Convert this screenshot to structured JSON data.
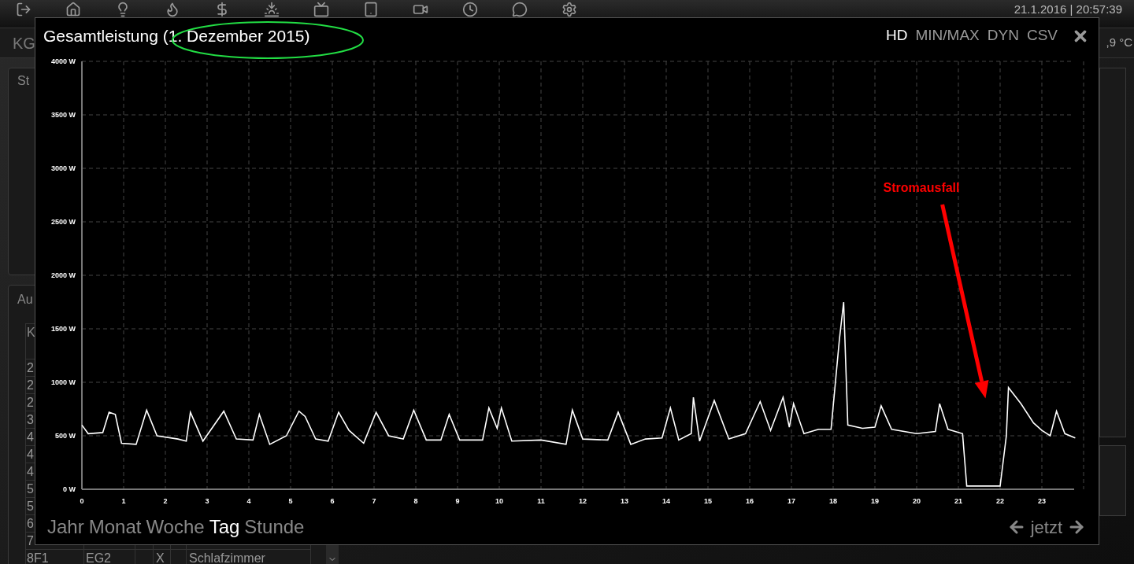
{
  "nav": {
    "datetime": "21.1.2016 | 20:57:39"
  },
  "tab_row": {
    "left_tab": "KG",
    "temperature": ",9 °C"
  },
  "panels": [
    {
      "heading": "St"
    },
    {
      "heading": "Au",
      "table": {
        "header": "K",
        "rows": [
          {
            "kennung": "2"
          },
          {
            "kennung": "2"
          },
          {
            "kennung": "2"
          },
          {
            "kennung": "3"
          },
          {
            "kennung": "4"
          },
          {
            "kennung": "4"
          },
          {
            "kennung": "4"
          },
          {
            "kennung": "5"
          },
          {
            "kennung": "5"
          },
          {
            "kennung": "6"
          },
          {
            "kennung": "7"
          },
          {
            "kennung": "8F1",
            "stockwerk": "EG2",
            "l2": "X",
            "ort": "Schlafzimmer"
          }
        ]
      }
    }
  ],
  "modal": {
    "title": "Gesamtleistung (1. Dezember 2015)",
    "options": [
      {
        "label": "HD",
        "selected": true
      },
      {
        "label": "MIN/MAX",
        "selected": false
      },
      {
        "label": "DYN",
        "selected": false
      },
      {
        "label": "CSV",
        "selected": false
      }
    ],
    "chart_data": {
      "type": "line",
      "x": [
        0,
        0.15,
        0.5,
        0.65,
        0.8,
        0.95,
        1.3,
        1.55,
        1.8,
        2.3,
        2.5,
        2.6,
        2.9,
        3.4,
        3.7,
        4.1,
        4.25,
        4.5,
        4.9,
        5.2,
        5.35,
        5.6,
        5.9,
        6.15,
        6.4,
        6.75,
        7.05,
        7.35,
        7.7,
        7.95,
        8.25,
        8.6,
        8.8,
        9.05,
        9.6,
        9.75,
        9.95,
        10.05,
        10.3,
        11,
        11.6,
        11.75,
        12,
        12.6,
        12.85,
        13.15,
        13.5,
        13.9,
        14.1,
        14.3,
        14.6,
        14.65,
        14.8,
        15.15,
        15.5,
        15.9,
        16.25,
        16.5,
        16.8,
        16.95,
        17.05,
        17.3,
        17.65,
        17.95,
        18.15,
        18.25,
        18.35,
        18.7,
        19,
        19.15,
        19.4,
        20,
        20.45,
        20.55,
        20.75,
        21.1,
        21.2,
        21.5,
        22,
        22.15,
        22.2,
        22.5,
        22.8,
        23,
        23.2,
        23.35,
        23.55,
        23.8
      ],
      "series": [
        {
          "color": "#ffffff",
          "values": [
            600,
            520,
            530,
            720,
            700,
            430,
            420,
            740,
            500,
            470,
            450,
            720,
            450,
            730,
            470,
            460,
            700,
            420,
            500,
            730,
            680,
            470,
            450,
            720,
            550,
            430,
            720,
            500,
            470,
            740,
            460,
            460,
            700,
            460,
            460,
            760,
            570,
            760,
            450,
            460,
            420,
            740,
            470,
            460,
            720,
            420,
            470,
            480,
            760,
            460,
            520,
            860,
            450,
            830,
            470,
            520,
            820,
            550,
            860,
            580,
            800,
            520,
            560,
            560,
            1400,
            1750,
            600,
            570,
            580,
            780,
            560,
            520,
            540,
            800,
            560,
            520,
            30,
            30,
            30,
            500,
            950,
            800,
            620,
            550,
            500,
            730,
            520,
            480
          ]
        }
      ],
      "xlim": [
        0,
        24
      ],
      "ylim": [
        0,
        4000
      ],
      "xticks": [
        0,
        1,
        2,
        3,
        4,
        5,
        6,
        7,
        8,
        9,
        10,
        11,
        12,
        13,
        14,
        15,
        16,
        17,
        18,
        19,
        20,
        21,
        22,
        23
      ],
      "yticks": [
        {
          "value": 0,
          "label": "0 W"
        },
        {
          "value": 500,
          "label": "500 W"
        },
        {
          "value": 1000,
          "label": "1000 W"
        },
        {
          "value": 1500,
          "label": "1500 W"
        },
        {
          "value": 2000,
          "label": "2000 W"
        },
        {
          "value": 2500,
          "label": "2500 W"
        },
        {
          "value": 3000,
          "label": "3000 W"
        },
        {
          "value": 3500,
          "label": "3500 W"
        },
        {
          "value": 4000,
          "label": "4000 W"
        }
      ],
      "grid": true,
      "annotations": [
        "Stromausfall"
      ]
    },
    "ranges": [
      {
        "label": "Jahr",
        "selected": false
      },
      {
        "label": "Monat",
        "selected": false
      },
      {
        "label": "Woche",
        "selected": false
      },
      {
        "label": "Tag",
        "selected": true
      },
      {
        "label": "Stunde",
        "selected": false
      }
    ],
    "now_label": "jetzt"
  }
}
